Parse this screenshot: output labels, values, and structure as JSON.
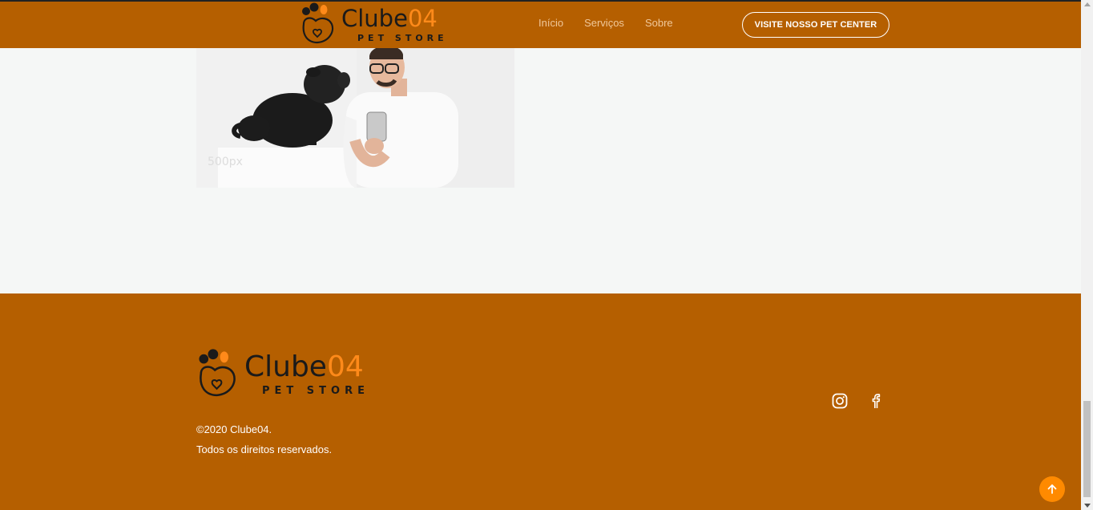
{
  "header": {
    "logo": {
      "word_primary": "Clube",
      "word_accent": "04",
      "subtitle": "PET STORE"
    },
    "nav": [
      {
        "label": "Início"
      },
      {
        "label": "Serviços"
      },
      {
        "label": "Sobre"
      }
    ],
    "cta_label": "VISITE NOSSO PET CENTER"
  },
  "photo": {
    "watermark": "500px"
  },
  "footer": {
    "logo": {
      "word_primary": "Clube",
      "word_accent": "04",
      "subtitle": "PET STORE"
    },
    "copyright": "©2020 Clube04.",
    "rights": "Todos os direitos reservados.",
    "social": [
      {
        "icon": "instagram-icon"
      },
      {
        "icon": "facebook-icon"
      }
    ]
  },
  "colors": {
    "brand": "#b55f00",
    "accent": "#ff8a1a",
    "background": "#f5f7f6"
  },
  "scroll_to_top": {
    "icon": "arrow-up-icon"
  }
}
